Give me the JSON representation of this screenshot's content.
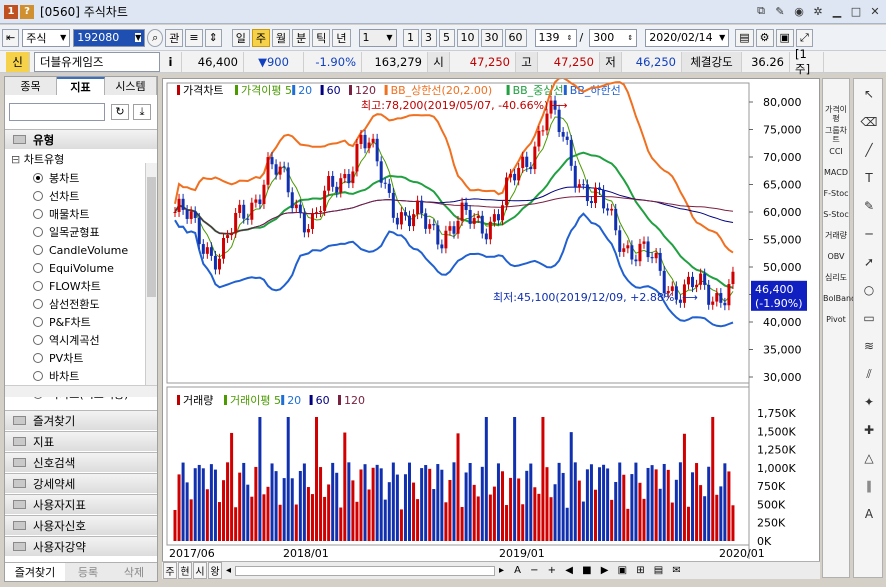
{
  "window": {
    "title": "[0560] 주식차트",
    "icon": "1",
    "icon2": "?"
  },
  "toolbar": {
    "market": "주식",
    "code": "192080",
    "btn_kwan": "관",
    "periods": [
      "일",
      "주",
      "월",
      "분",
      "틱",
      "년"
    ],
    "selected_period": "주",
    "interval_select": "1",
    "intervals": [
      "1",
      "3",
      "5",
      "10",
      "30",
      "60"
    ],
    "count": "139",
    "total": "300",
    "date": "2020/02/14",
    "right_label": "[1주]"
  },
  "quote": {
    "sin": "신",
    "name": "더블유게임즈",
    "info": "i",
    "price": "46,400",
    "change": "▼900",
    "pct": "-1.90%",
    "volume": "163,279",
    "open_lab": "시",
    "open": "47,250",
    "high_lab": "고",
    "high": "47,250",
    "low_lab": "저",
    "low": "46,250",
    "strength_lab": "체결강도",
    "strength": "36.26"
  },
  "left": {
    "tabs": [
      "종목",
      "지표",
      "시스템"
    ],
    "active_tab": "지표",
    "search_placeholder": "",
    "section": "유형",
    "tree_root": "차트유형",
    "items": [
      "봉차트",
      "선차트",
      "매물차트",
      "일목균형표",
      "CandleVolume",
      "EquiVolume",
      "FLOW차트",
      "삼선전환도",
      "P&F차트",
      "역시계곡선",
      "PV차트",
      "바차트",
      "바차트(시고저종)"
    ],
    "selected_item": "봉차트",
    "groups": [
      "즐겨찾기",
      "지표",
      "신호검색",
      "강세약세",
      "사용자지표",
      "사용자신호",
      "사용자강약"
    ],
    "bottom_tabs": [
      "즐겨찾기",
      "등록",
      "삭제"
    ]
  },
  "chart": {
    "legend": [
      {
        "label": "가격차트",
        "color": "#c00000"
      },
      {
        "label": "가격이평 5",
        "color": "#4a9a00"
      },
      {
        "label": "20",
        "color": "#1e6ed8"
      },
      {
        "label": "60",
        "color": "#000080"
      },
      {
        "label": "120",
        "color": "#7a2040"
      },
      {
        "label": "BB_상한선(20,2.00)",
        "color": "#f07020"
      },
      {
        "label": "BB_중심선",
        "color": "#20a040"
      },
      {
        "label": "BB_하한선",
        "color": "#2060d0"
      }
    ],
    "max_label": "최고:78,200(2019/05/07, -40.66%)",
    "min_label": "최저:45,100(2019/12/09, +2.88%)",
    "last_price": "46,400",
    "last_pct": "(-1.90%)",
    "y_ticks": [
      "80,000",
      "75,000",
      "70,000",
      "65,000",
      "60,000",
      "55,000",
      "50,000",
      "45,000",
      "40,000",
      "35,000",
      "30,000"
    ],
    "vol_legend": [
      {
        "label": "거래량",
        "color": "#c00000"
      },
      {
        "label": "거래이평 5",
        "color": "#4a9a00"
      },
      {
        "label": "20",
        "color": "#1e6ed8"
      },
      {
        "label": "60",
        "color": "#000080"
      },
      {
        "label": "120",
        "color": "#7a2040"
      }
    ],
    "vol_ticks": [
      "1,750K",
      "1,500K",
      "1,250K",
      "1,000K",
      "750K",
      "500K",
      "250K",
      "0K"
    ],
    "x_ticks": [
      "2017/06",
      "2018/01",
      "2019/01",
      "2020/01"
    ]
  },
  "chart_data": {
    "type": "line",
    "x": [
      "2017/06",
      "2017/09",
      "2018/01",
      "2018/04",
      "2018/07",
      "2018/10",
      "2019/01",
      "2019/03",
      "2019/05",
      "2019/07",
      "2019/10",
      "2019/12",
      "2020/02"
    ],
    "series": [
      {
        "name": "가격차트",
        "values": [
          60000,
          52000,
          68000,
          58000,
          73000,
          58000,
          57000,
          60000,
          78200,
          62000,
          52000,
          45100,
          46400
        ]
      }
    ],
    "ylim": [
      30000,
      82000
    ]
  },
  "bottombar": {
    "tabs": [
      "주",
      "현",
      "시",
      "왕"
    ]
  },
  "rightbar": {
    "items": [
      "가격이평",
      "그룹차트",
      "CCI",
      "MACD",
      "F-Stoc",
      "S-Stoc",
      "거래량",
      "OBV",
      "심리도",
      "BolBand",
      "Pivot"
    ]
  }
}
